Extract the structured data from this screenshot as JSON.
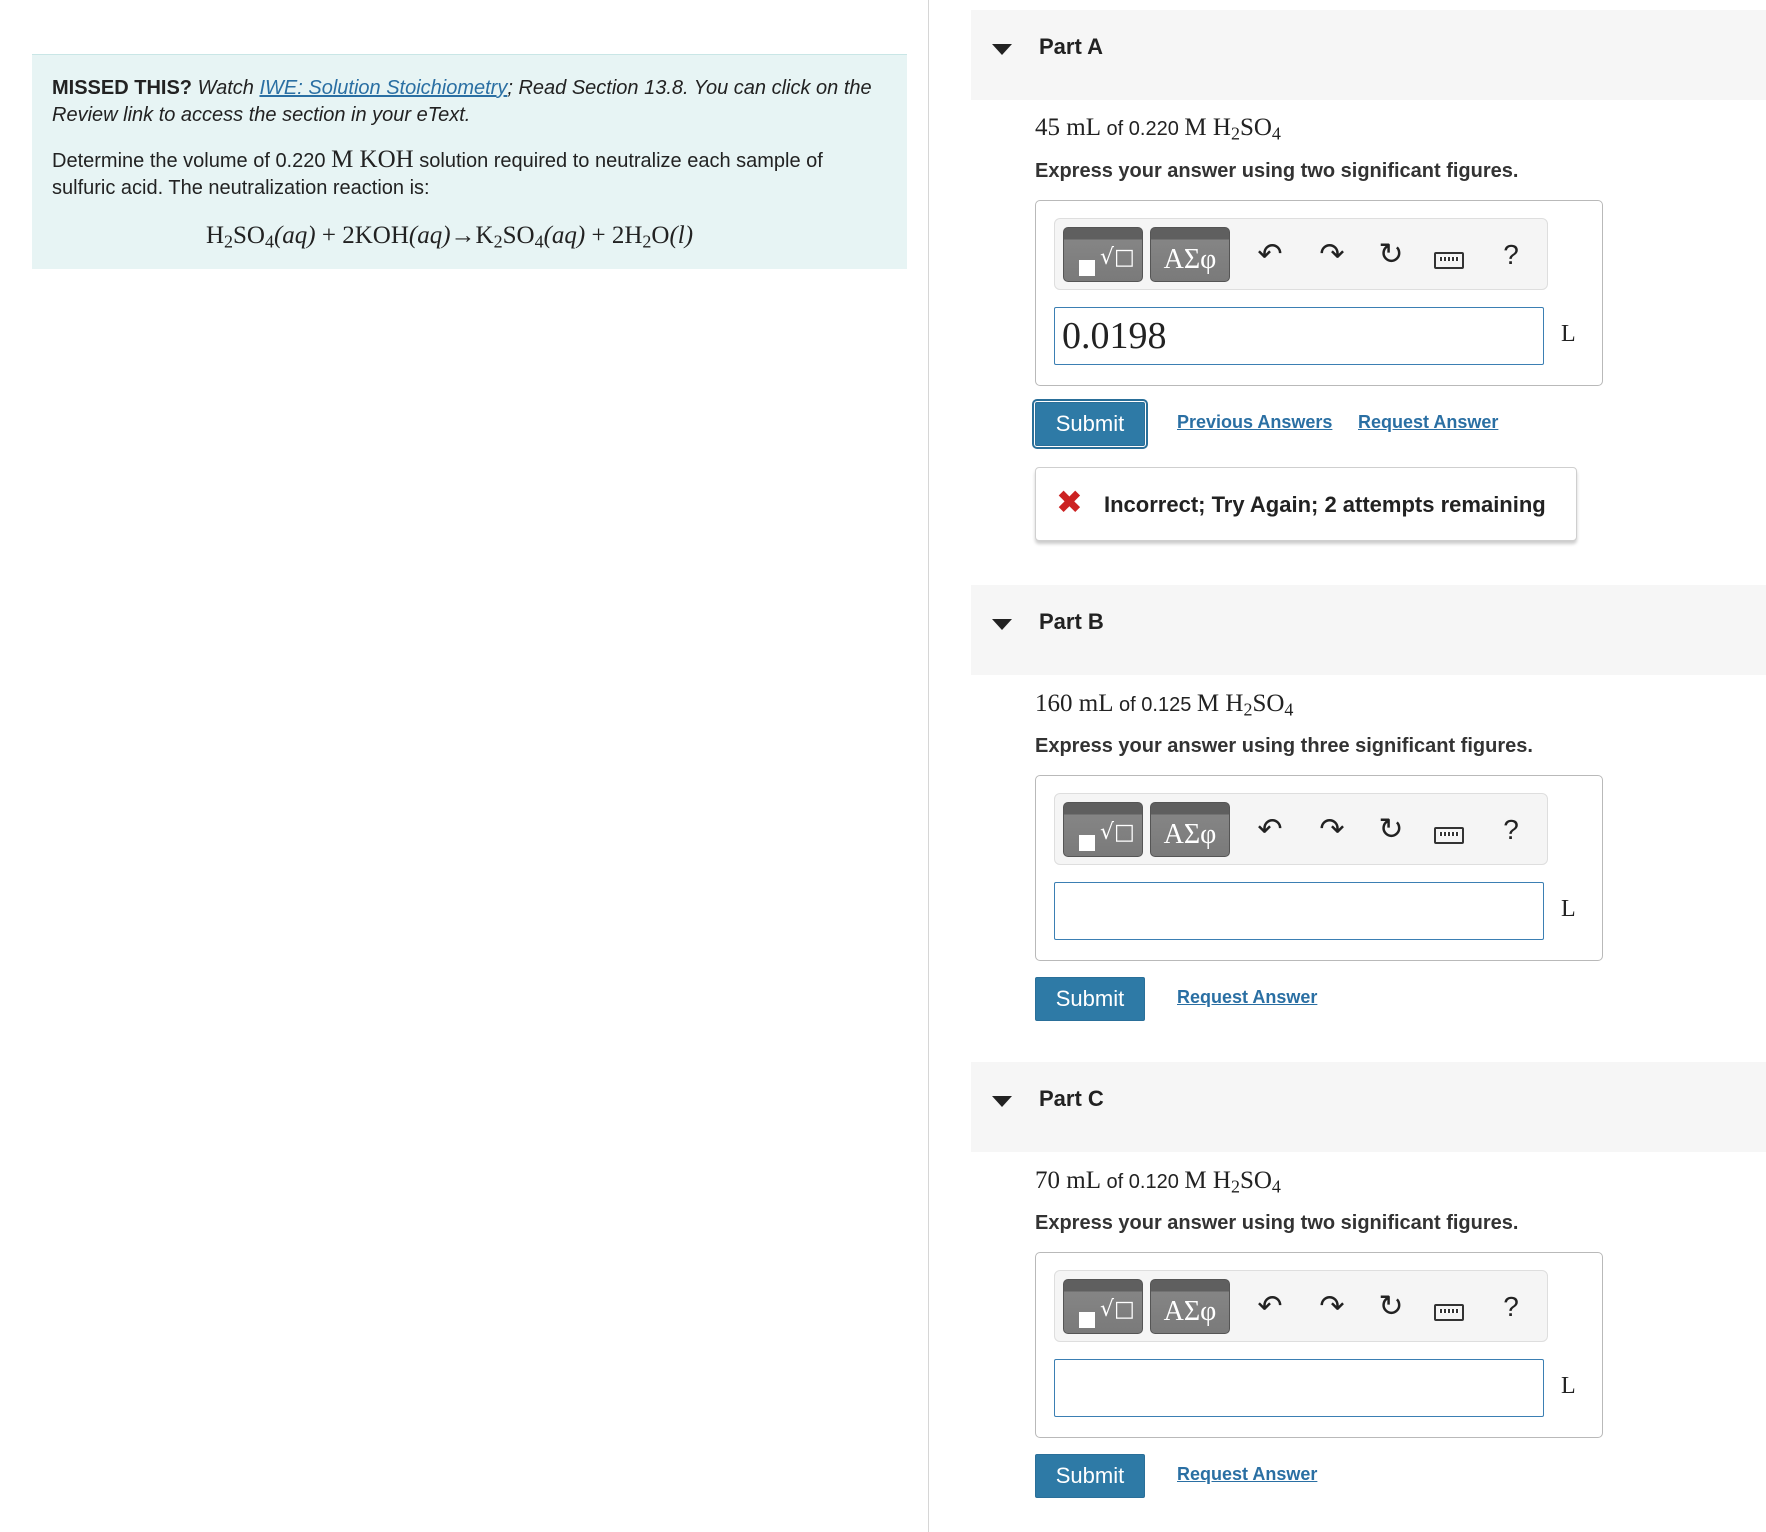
{
  "intro": {
    "missed_label": "MISSED THIS?",
    "watch_text": "Watch",
    "watch_link": "IWE: Solution Stoichiometry",
    "read_text": "; Read Section 13.8. You can click on the Review link to access the section in your eText.",
    "desc_before": "Determine the volume of 0.220",
    "desc_math": "M KOH",
    "desc_after": "solution required to neutralize each sample of sulfuric acid. The neutralization reaction is:",
    "equation": {
      "r1": "H",
      "r1_sub": "2",
      "r1b": "SO",
      "r1b_sub": "4",
      "aq1": "(aq)",
      "plus1": " + 2KOH",
      "aq2": "(aq)",
      "arrow": "→K",
      "p1_sub": "2",
      "p1b": "SO",
      "p1b_sub": "4",
      "aq3": "(aq)",
      "plus2": " + 2H",
      "p2_sub": "2",
      "p2b": "O",
      "liq": "(l)"
    }
  },
  "toolbar": {
    "template_icon": "template-icon",
    "greek_label": "ΑΣφ",
    "undo_icon": "undo-icon",
    "redo_icon": "redo-icon",
    "reset_icon": "reset-icon",
    "keyboard_icon": "keyboard-icon",
    "help_label": "?"
  },
  "parts": [
    {
      "title": "Part A",
      "prompt_volume": "45 mL",
      "prompt_mid": "of 0.220",
      "prompt_conc": "M H",
      "instruction": "Express your answer using two significant figures.",
      "answer_value": "0.0198",
      "unit": "L",
      "submit_label": "Submit",
      "previous_answers_label": "Previous Answers",
      "request_answer_label": "Request Answer",
      "feedback": "Incorrect; Try Again; 2 attempts remaining"
    },
    {
      "title": "Part B",
      "prompt_volume": "160 mL",
      "prompt_mid": "of 0.125",
      "prompt_conc": "M H",
      "instruction": "Express your answer using three significant figures.",
      "answer_value": "",
      "unit": "L",
      "submit_label": "Submit",
      "request_answer_label": "Request Answer"
    },
    {
      "title": "Part C",
      "prompt_volume": "70 mL",
      "prompt_mid": "of 0.120",
      "prompt_conc": "M H",
      "instruction": "Express your answer using two significant figures.",
      "answer_value": "",
      "unit": "L",
      "submit_label": "Submit",
      "request_answer_label": "Request Answer"
    }
  ],
  "formula": {
    "sub1": "2",
    "mid": "SO",
    "sub2": "4"
  },
  "colors": {
    "accent": "#2e7aa6",
    "intro_bg": "#e7f4f4",
    "error": "#cc2222",
    "link": "#2a6fa3"
  }
}
